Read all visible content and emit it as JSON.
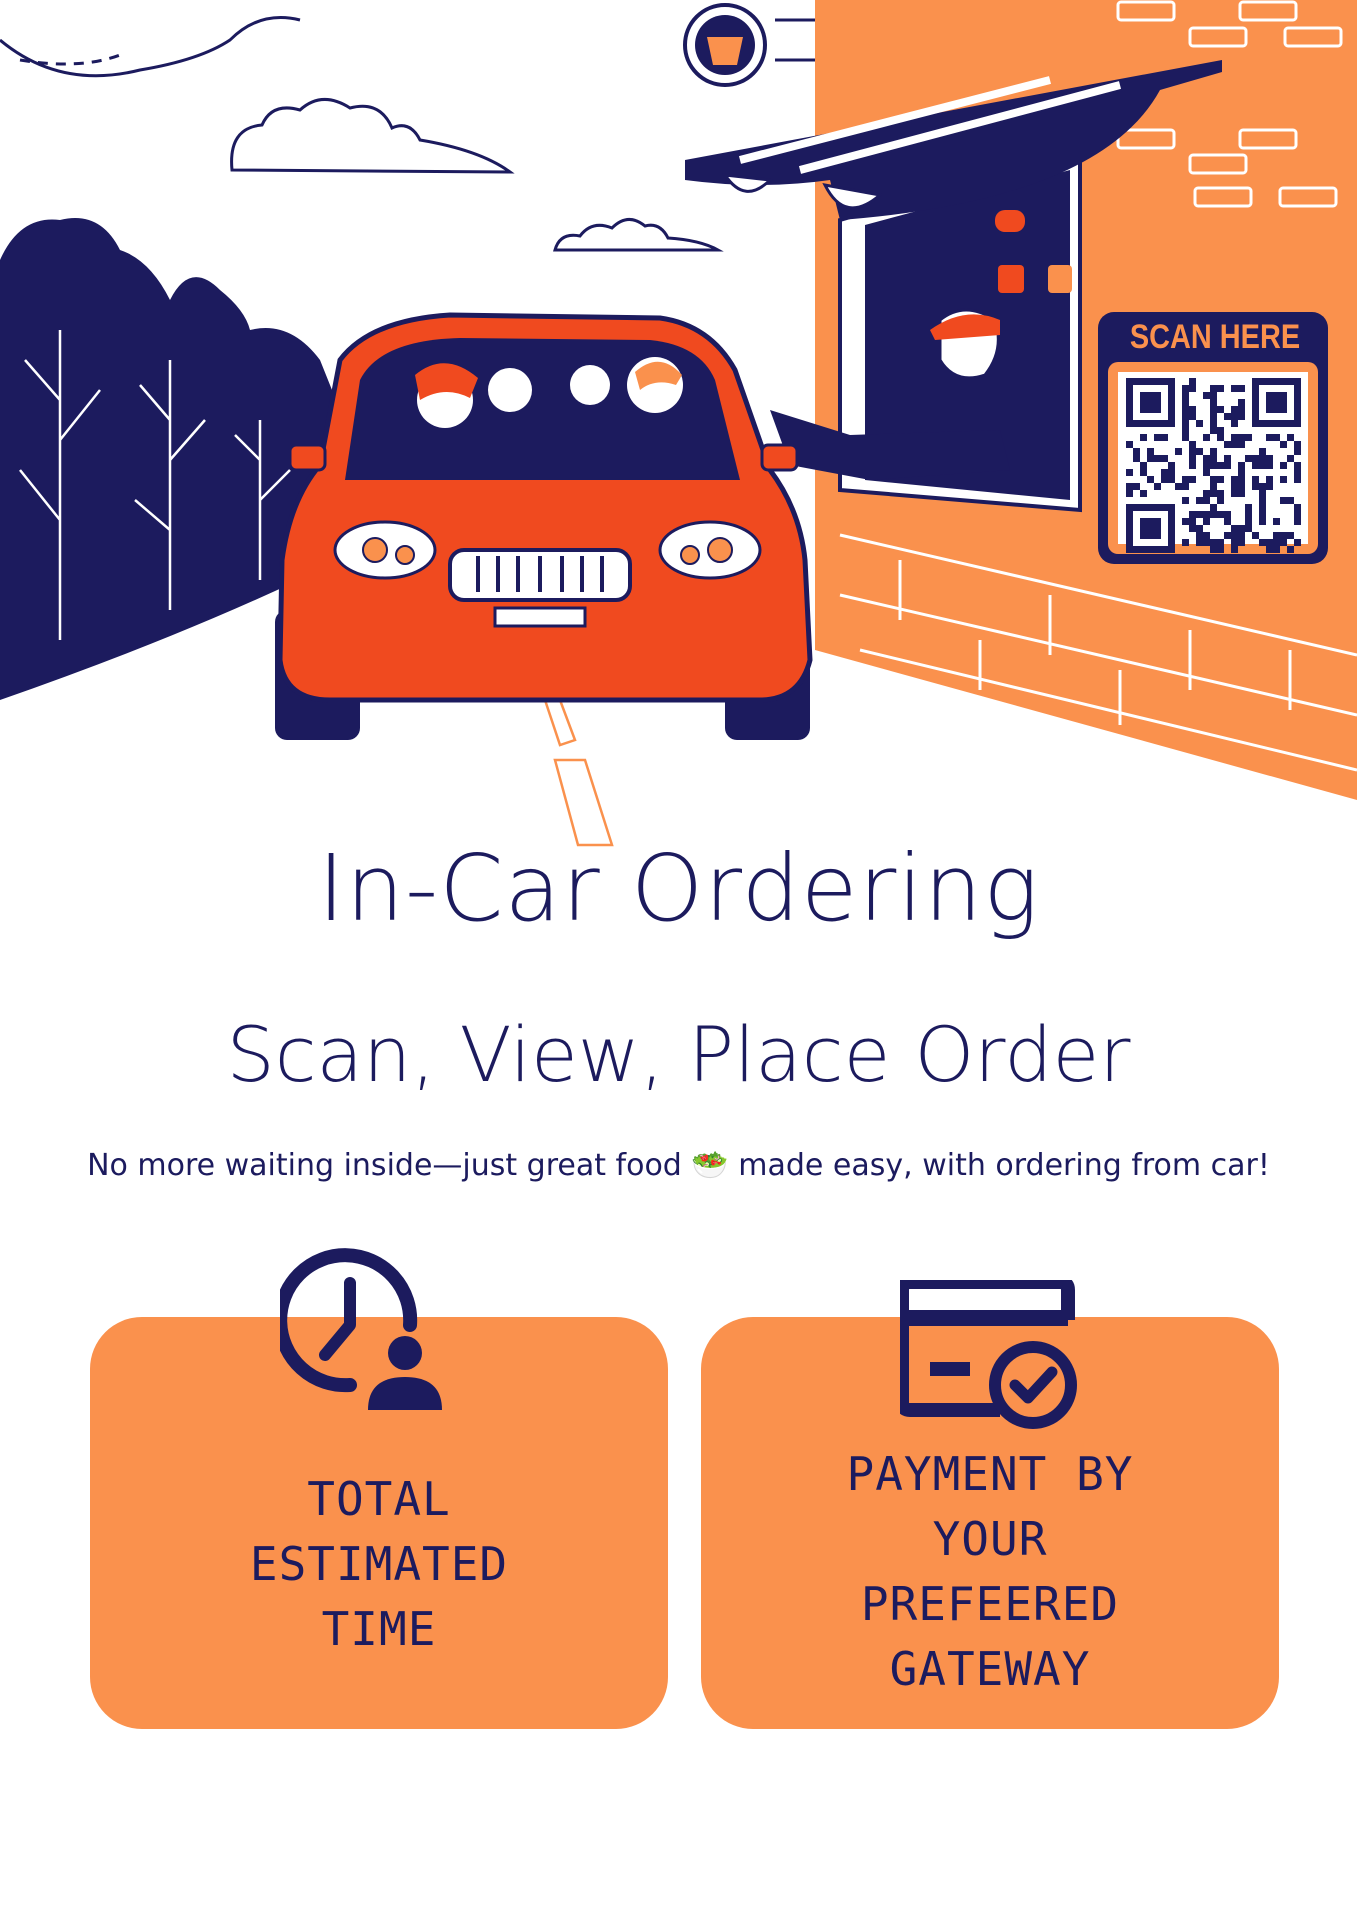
{
  "poster": {
    "scan_label": "SCAN HERE",
    "title": "In-Car Ordering",
    "subtitle": "Scan, View, Place Order",
    "tagline": "No more waiting inside—just great food 🥗 made easy, with ordering from car!",
    "features": [
      {
        "icon": "clock-user-icon",
        "lines": [
          "TOTAL",
          "ESTIMATED",
          "TIME"
        ]
      },
      {
        "icon": "card-check-icon",
        "lines": [
          "PAYMENT BY",
          "YOUR",
          "PREFEERED",
          "GATEWAY"
        ]
      }
    ]
  },
  "colors": {
    "navy": "#1c1b5e",
    "orange": "#fa914d",
    "red": "#f04a1f",
    "white": "#ffffff"
  }
}
